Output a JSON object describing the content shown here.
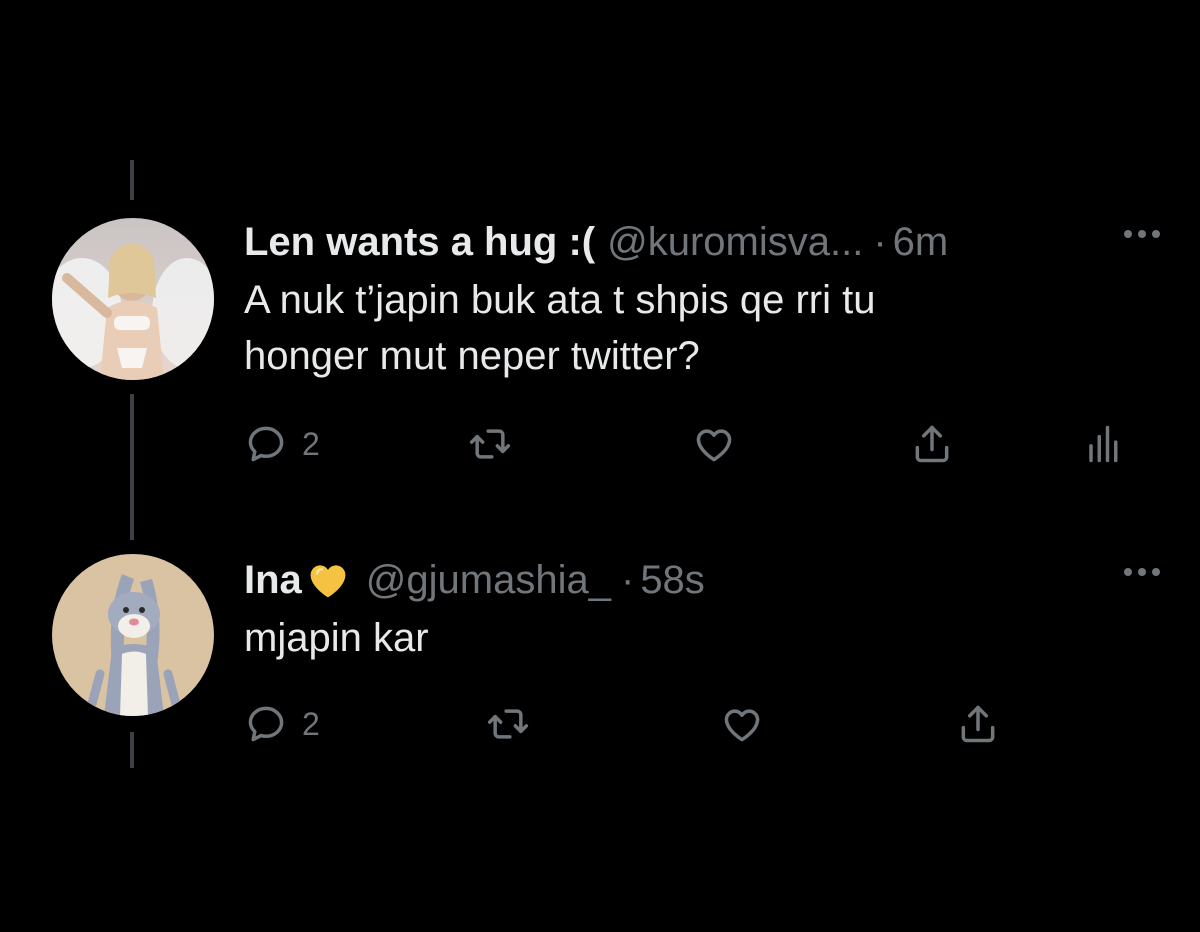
{
  "tweets": [
    {
      "display_name": "Len wants a hug :(",
      "handle": "@kuromisva...",
      "separator": "·",
      "time": "6m",
      "text_line_1": "A nuk t’japin buk ata t shpis qe rri tu",
      "text_line_2": "honger mut neper twitter?",
      "reply_count": "2",
      "avatar": "avatar-woman-with-wings-photo"
    },
    {
      "display_name": "Ina",
      "display_name_emoji": "yellow-heart-icon",
      "handle": "@gjumashia_",
      "separator": "·",
      "time": "58s",
      "text_line_1": "mjapin kar",
      "reply_count": "2",
      "avatar": "avatar-bugs-bunny-cartoon"
    }
  ],
  "icons": {
    "reply": "speech-bubble-icon",
    "retweet": "retweet-icon",
    "like": "heart-outline-icon",
    "share": "share-upload-icon",
    "analytics": "bar-chart-icon",
    "more": "ellipsis-icon"
  },
  "colors": {
    "background": "#000000",
    "primary_text": "#e7e9ea",
    "secondary_text": "#71767b",
    "thread_line": "#3d4044",
    "yellow_heart": "#f5c242"
  }
}
